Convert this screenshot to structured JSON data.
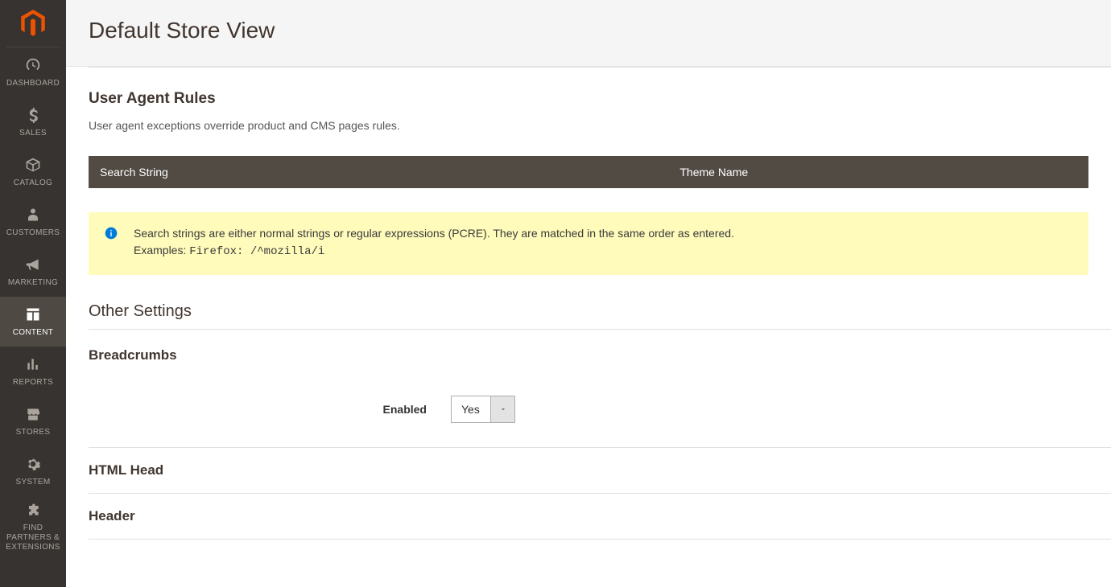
{
  "header": {
    "title": "Default Store View"
  },
  "sidebar": {
    "items": [
      {
        "label": "DASHBOARD"
      },
      {
        "label": "SALES"
      },
      {
        "label": "CATALOG"
      },
      {
        "label": "CUSTOMERS"
      },
      {
        "label": "MARKETING"
      },
      {
        "label": "CONTENT"
      },
      {
        "label": "REPORTS"
      },
      {
        "label": "STORES"
      },
      {
        "label": "SYSTEM"
      },
      {
        "label": "FIND\nPARTNERS &\nEXTENSIONS"
      }
    ]
  },
  "user_agent_rules": {
    "title": "User Agent Rules",
    "desc": "User agent exceptions override product and CMS pages rules.",
    "col_search": "Search String",
    "col_theme": "Theme Name",
    "info_line1": "Search strings are either normal strings or regular expressions (PCRE). They are matched in the same order as entered.",
    "info_line2_prefix": "Examples: ",
    "info_line2_code": "Firefox: /^mozilla/i"
  },
  "other_settings": {
    "title": "Other Settings"
  },
  "breadcrumbs": {
    "title": "Breadcrumbs",
    "enabled_label": "Enabled",
    "enabled_value": "Yes"
  },
  "html_head": {
    "title": "HTML Head"
  },
  "header_section": {
    "title": "Header"
  }
}
